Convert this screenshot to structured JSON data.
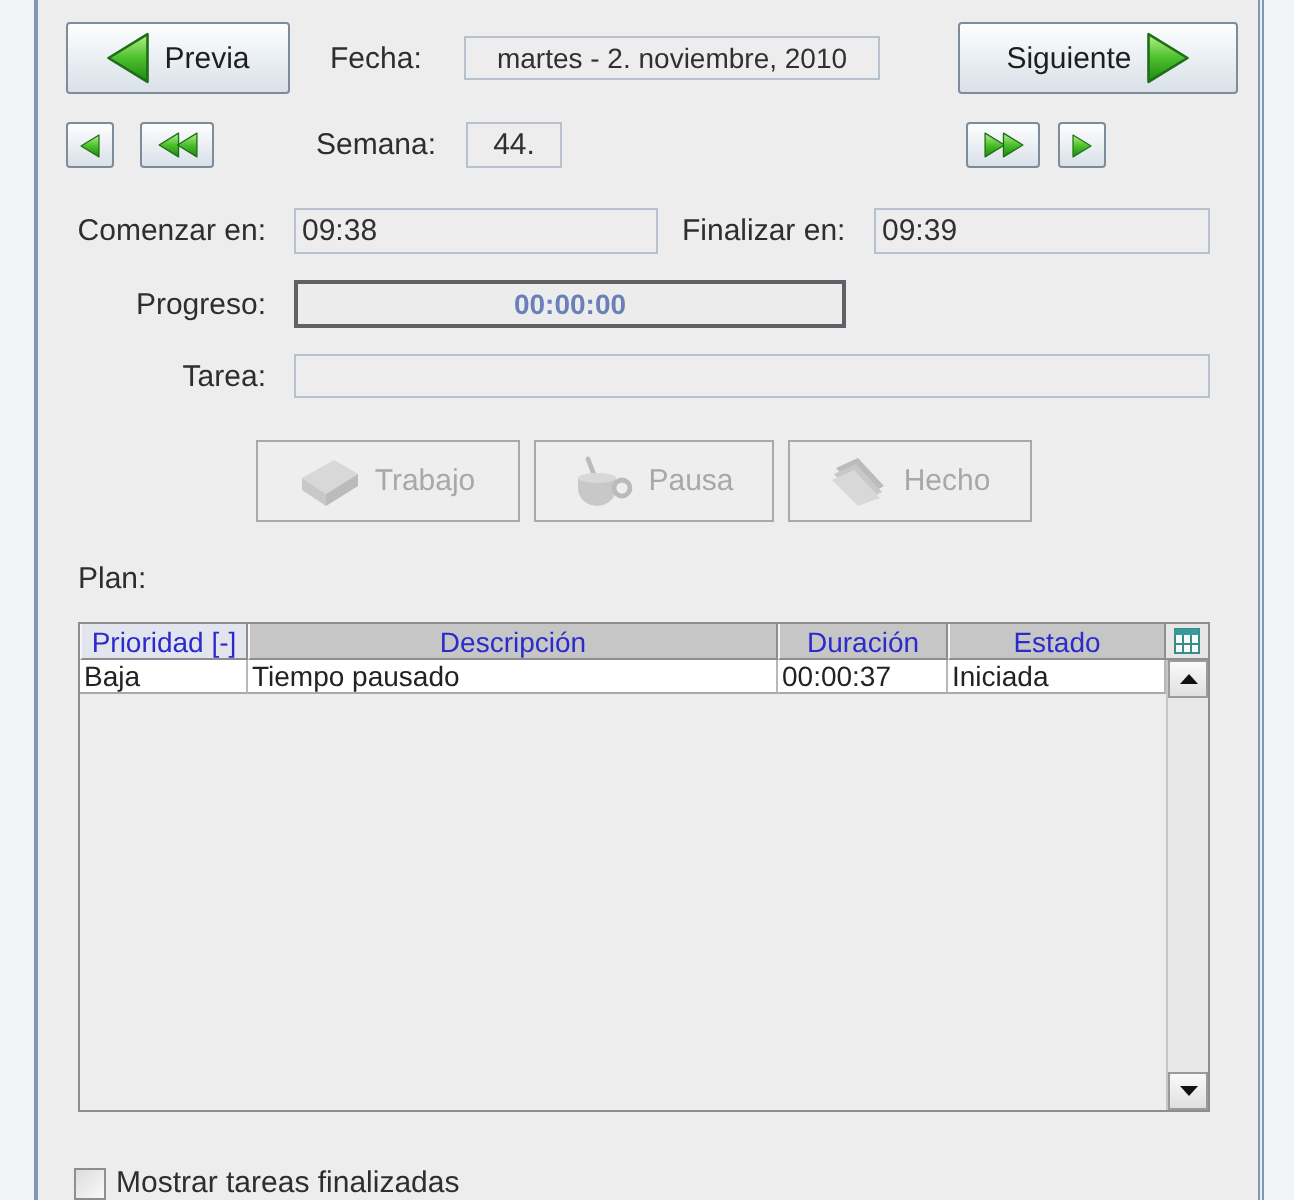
{
  "navigation": {
    "previous_button": "Previa",
    "date_label": "Fecha:",
    "date": "martes - 2. noviembre, 2010",
    "next_button": "Siguiente",
    "week_label": "Semana:",
    "week": "44."
  },
  "times": {
    "start_label": "Comenzar en:",
    "start": "09:38",
    "end_label": "Finalizar en:",
    "end": "09:39",
    "progress_label": "Progreso:",
    "progress": {
      "text": "00:00:00",
      "level": 0
    },
    "task_label": "Tarea:"
  },
  "actions": [
    {
      "kind": "work",
      "label": "Trabajo",
      "disabled": true
    },
    {
      "kind": "pause",
      "label": "Pausa",
      "disabled": true
    },
    {
      "kind": "done",
      "label": "Hecho",
      "disabled": true
    }
  ],
  "plan": {
    "label": "Plan:",
    "table": {
      "columns": [
        {
          "label": "Prioridad [-]",
          "sorted": true
        },
        {
          "label": "Descripción",
          "sorted": false
        },
        {
          "label": "Duración",
          "sorted": false
        },
        {
          "label": "Estado",
          "sorted": false
        }
      ],
      "rows": [
        [
          "Baja",
          "Tiempo pausado",
          "00:00:37",
          "Iniciada"
        ]
      ]
    }
  },
  "show_finished": {
    "label": "Mostrar tareas finalizadas",
    "checked": false
  }
}
